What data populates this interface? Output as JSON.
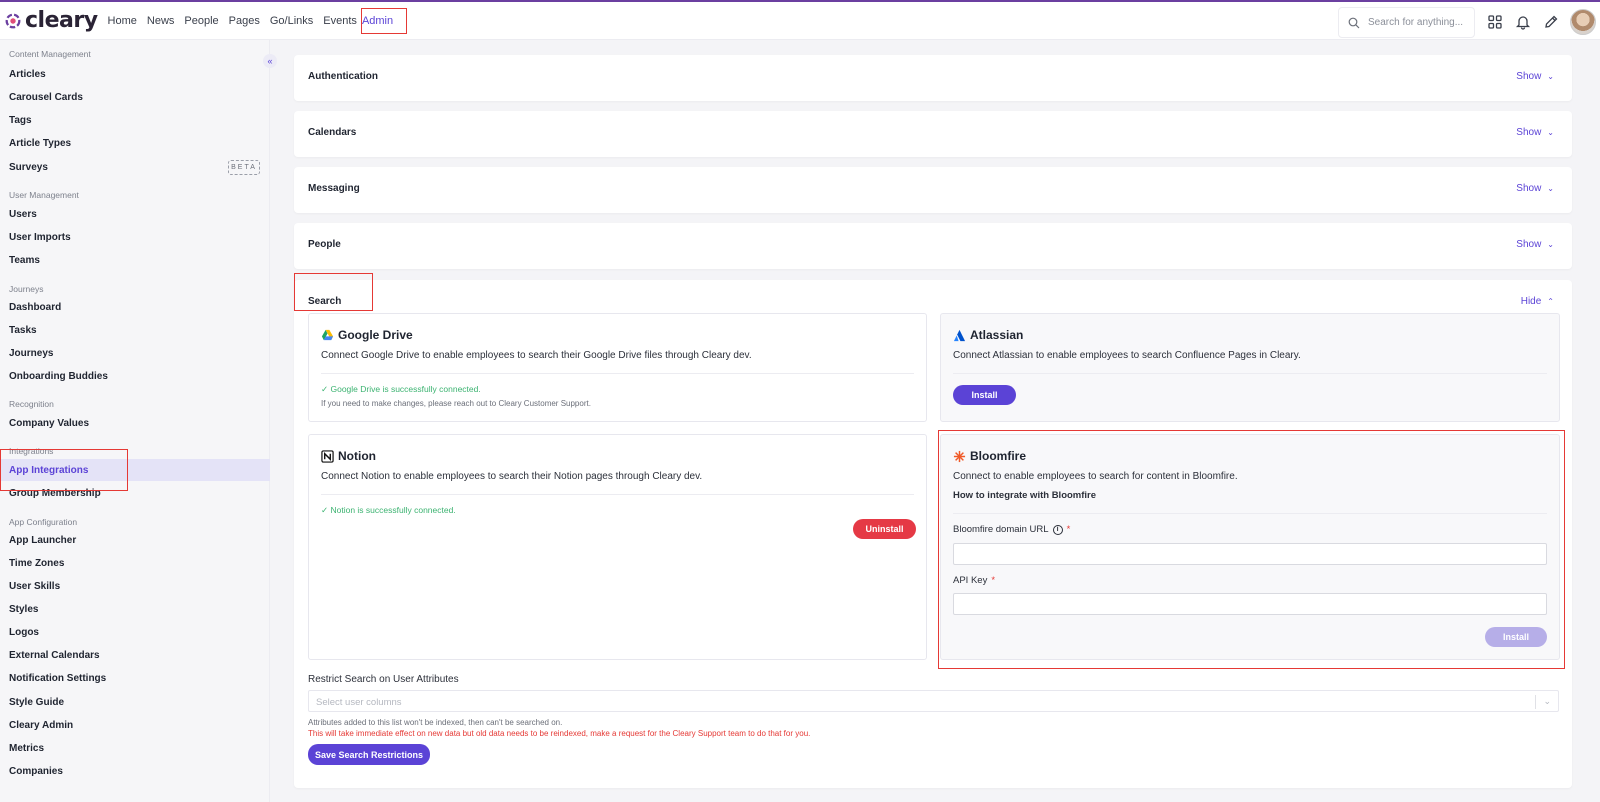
{
  "app": {
    "logo_text": "cleary"
  },
  "nav": {
    "items": [
      "Home",
      "News",
      "People",
      "Pages",
      "Go/Links",
      "Events"
    ],
    "active": "Admin"
  },
  "search": {
    "placeholder": "Search for anything..."
  },
  "sidebar": {
    "collapse_icon": "«",
    "sections": {
      "content": "Content Management",
      "user": "User Management",
      "journeys": "Journeys",
      "recognition": "Recognition",
      "integrations": "Integrations",
      "app_config": "App Configuration"
    },
    "items": {
      "articles": "Articles",
      "carousel": "Carousel Cards",
      "tags": "Tags",
      "article_types": "Article Types",
      "surveys": "Surveys",
      "surveys_badge": "BETA",
      "users": "Users",
      "user_imports": "User Imports",
      "teams": "Teams",
      "dashboard": "Dashboard",
      "tasks": "Tasks",
      "journeys": "Journeys",
      "onboarding": "Onboarding Buddies",
      "company_values": "Company Values",
      "app_integrations": "App Integrations",
      "group_membership": "Group Membership",
      "app_launcher": "App Launcher",
      "time_zones": "Time Zones",
      "user_skills": "User Skills",
      "styles": "Styles",
      "logos": "Logos",
      "external_calendars": "External Calendars",
      "notification_settings": "Notification Settings",
      "style_guide": "Style Guide",
      "cleary_admin": "Cleary Admin",
      "metrics": "Metrics",
      "companies": "Companies"
    }
  },
  "sections": {
    "authentication": {
      "title": "Authentication",
      "toggle": "Show"
    },
    "calendars": {
      "title": "Calendars",
      "toggle": "Show"
    },
    "messaging": {
      "title": "Messaging",
      "toggle": "Show"
    },
    "people": {
      "title": "People",
      "toggle": "Show"
    },
    "search": {
      "title": "Search",
      "toggle": "Hide"
    }
  },
  "integrations": {
    "google_drive": {
      "name": "Google Drive",
      "description": "Connect Google Drive to enable employees to search their Google Drive files through Cleary dev.",
      "status": "✓ Google Drive is successfully connected.",
      "note": "If you need to make changes, please reach out to Cleary Customer Support."
    },
    "atlassian": {
      "name": "Atlassian",
      "description": "Connect Atlassian to enable employees to search Confluence Pages in Cleary.",
      "button": "Install"
    },
    "notion": {
      "name": "Notion",
      "description": "Connect Notion to enable employees to search their Notion pages through Cleary dev.",
      "status": "✓ Notion is successfully connected.",
      "button": "Uninstall"
    },
    "bloomfire": {
      "name": "Bloomfire",
      "description": "Connect to enable employees to search for content in Bloomfire.",
      "howto": "How to integrate with Bloomfire",
      "domain_label": "Bloomfire domain URL",
      "api_label": "API Key",
      "required_mark": "*",
      "info_icon": "i",
      "button": "Install"
    }
  },
  "restrict": {
    "label": "Restrict Search on User Attributes",
    "placeholder": "Select user columns",
    "hint": "Attributes added to this list won't be indexed, then can't be searched on.",
    "warning": "This will take immediate effect on new data but old data needs to be reindexed, make a request for the Cleary Support team to do that for you.",
    "button": "Save Search Restrictions"
  },
  "colors": {
    "accent": "#5b43d6",
    "danger": "#e53945",
    "success": "#3cb371",
    "highlight": "#e53935"
  }
}
